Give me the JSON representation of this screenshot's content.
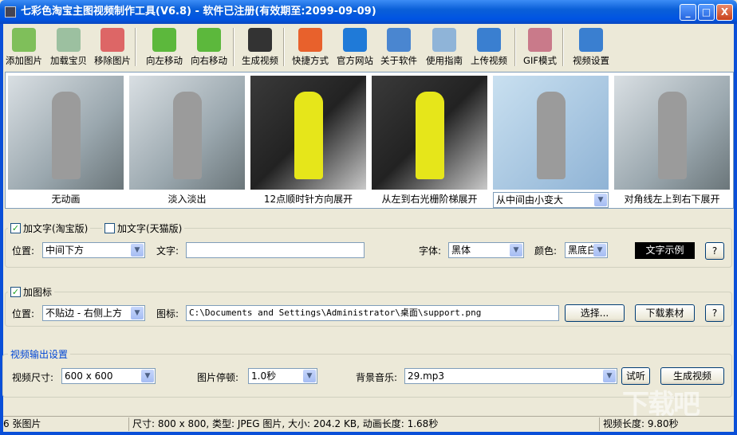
{
  "window": {
    "title": "七彩色淘宝主图视频制作工具(V6.8) - 软件已注册(有效期至:2099-09-09)",
    "minimize": "_",
    "maximize": "□",
    "close": "X"
  },
  "toolbar": [
    {
      "label": "添加图片",
      "icon": "add-image-icon",
      "color": "#7fbf5a"
    },
    {
      "label": "加载宝贝",
      "icon": "load-item-icon",
      "color": "#9cc0a0"
    },
    {
      "label": "移除图片",
      "icon": "remove-image-icon",
      "color": "#d66"
    },
    {
      "label": "向左移动",
      "icon": "arrow-left-icon",
      "color": "#5cb83c"
    },
    {
      "label": "向右移动",
      "icon": "arrow-right-icon",
      "color": "#5cb83c"
    },
    {
      "label": "生成视频",
      "icon": "clapperboard-icon",
      "color": "#333"
    },
    {
      "label": "快捷方式",
      "icon": "cubes-icon",
      "color": "#e8612c"
    },
    {
      "label": "官方网站",
      "icon": "ie-icon",
      "color": "#1f7ad8"
    },
    {
      "label": "关于软件",
      "icon": "info-icon",
      "color": "#4a86d0"
    },
    {
      "label": "使用指南",
      "icon": "guide-icon",
      "color": "#8fb4d8"
    },
    {
      "label": "上传视频",
      "icon": "upload-globe-icon",
      "color": "#3a7fd0"
    },
    {
      "label": "GIF模式",
      "icon": "gif-film-icon",
      "color": "#c97a8a"
    },
    {
      "label": "视频设置",
      "icon": "gear-icon",
      "color": "#3a7fd0"
    }
  ],
  "thumbnails": [
    {
      "effect": "无动画",
      "style": "grey"
    },
    {
      "effect": "淡入淡出",
      "style": "grey"
    },
    {
      "effect": "12点顺时针方向展开",
      "style": "yellow"
    },
    {
      "effect": "从左到右光栅阶梯展开",
      "style": "yellow"
    },
    {
      "effect": "从中间由小变大",
      "style": "blue",
      "selected": true
    },
    {
      "effect": "对角线左上到右下展开",
      "style": "grey"
    }
  ],
  "text_section": {
    "taobao_label": "加文字(淘宝版)",
    "taobao_checked": true,
    "tmall_label": "加文字(天猫版)",
    "tmall_checked": false,
    "position_label": "位置:",
    "position_value": "中间下方",
    "text_label": "文字:",
    "text_value": "",
    "font_label": "字体:",
    "font_value": "黑体",
    "color_label": "颜色:",
    "color_value": "黑底白字",
    "sample_label": "文字示例",
    "help": "?"
  },
  "icon_section": {
    "label": "加图标",
    "checked": true,
    "position_label": "位置:",
    "position_value": "不贴边 - 右侧上方",
    "icon_label": "图标:",
    "icon_path": "C:\\Documents and Settings\\Administrator\\桌面\\support.png",
    "choose_label": "选择...",
    "download_label": "下载素材",
    "help": "?"
  },
  "output_section": {
    "title": "视频输出设置",
    "size_label": "视频尺寸:",
    "size_value": "600 x 600",
    "pause_label": "图片停顿:",
    "pause_value": "1.0秒",
    "music_label": "背景音乐:",
    "music_value": "29.mp3",
    "listen_label": "试听",
    "generate_label": "生成视频"
  },
  "status": {
    "count": "6 张图片",
    "info": "尺寸: 800 x 800, 类型: JPEG 图片, 大小: 204.2 KB, 动画长度: 1.68秒",
    "length": "视频长度: 9.80秒"
  },
  "watermark": "下载吧"
}
